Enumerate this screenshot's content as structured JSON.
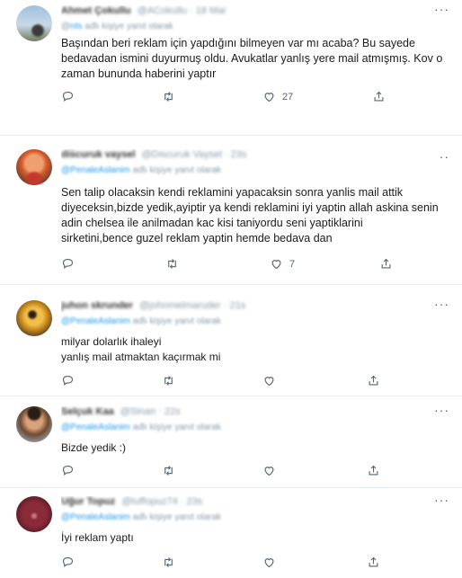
{
  "tweets": [
    {
      "name": "Ahmet Çokullu",
      "handle": "@ACokullu · 18 Mar",
      "reply_prefix": "@",
      "reply_user": "nts",
      "reply_suffix": " adlı kişiye yanıt olarak",
      "lines": [
        "Başından beri reklam için yapdığını bilmeyen var mı acaba? Bu sayede",
        "bedavadan ismini duyurmuş oldu. Avukatlar yanlış yere mail atmışmış. Kov o",
        "zaman bununda haberini yaptır"
      ],
      "likes": "27"
    },
    {
      "name": "dis̈curuk vaysel",
      "handle": "@Discuruk Vaysel · 23s",
      "reply_prefix": "",
      "reply_user": "@PenaleAslanim",
      "reply_suffix": " adlı kişiye yanıt olarak",
      "lines": [
        "Sen talip olacaksin kendi reklamini yapacaksin sonra yanlis mail attik",
        "diyeceksin,bizde yedik,ayiptir ya kendi reklamini iyi yaptin allah askina senin",
        "adin chelsea ile anilmadan kac kisi taniyordu seni yaptiklarini",
        "sirketini,bence guzel reklam yaptin hemde bedava dan"
      ],
      "likes": "7"
    },
    {
      "name": "juhon skrunder",
      "handle": "@johnmelmaruder · 21s",
      "reply_prefix": "",
      "reply_user": "@PenaleAslanim",
      "reply_suffix": " adlı kişiye yanıt olarak",
      "lines": [
        "milyar dolarlık ihaleyi",
        "yanlış mail atmaktan kaçırmak mi"
      ],
      "likes": ""
    },
    {
      "name": "Selçuk Kaa",
      "handle": "@Sinan · 22s",
      "reply_prefix": "",
      "reply_user": "@PenaleAslanim",
      "reply_suffix": " adlı kişiye yanıt olarak",
      "lines": [
        "Bizde yedik :)"
      ],
      "likes": ""
    },
    {
      "name": "Uğur Topuz",
      "handle": "@tuffopuz74 · 23s",
      "reply_prefix": "",
      "reply_user": "@PenaleAslanim",
      "reply_suffix": " adlı kişiye yanıt olarak",
      "lines": [
        "İyi reklam yaptı"
      ],
      "likes": ""
    }
  ],
  "more_glyph": "···",
  "icons": {
    "reply": "reply-icon",
    "retweet": "retweet-icon",
    "like": "heart-icon",
    "share": "share-icon"
  },
  "colors": {
    "accent": "#1d9bf0",
    "secondary_text": "#536471",
    "divider": "#e6ecf0"
  }
}
